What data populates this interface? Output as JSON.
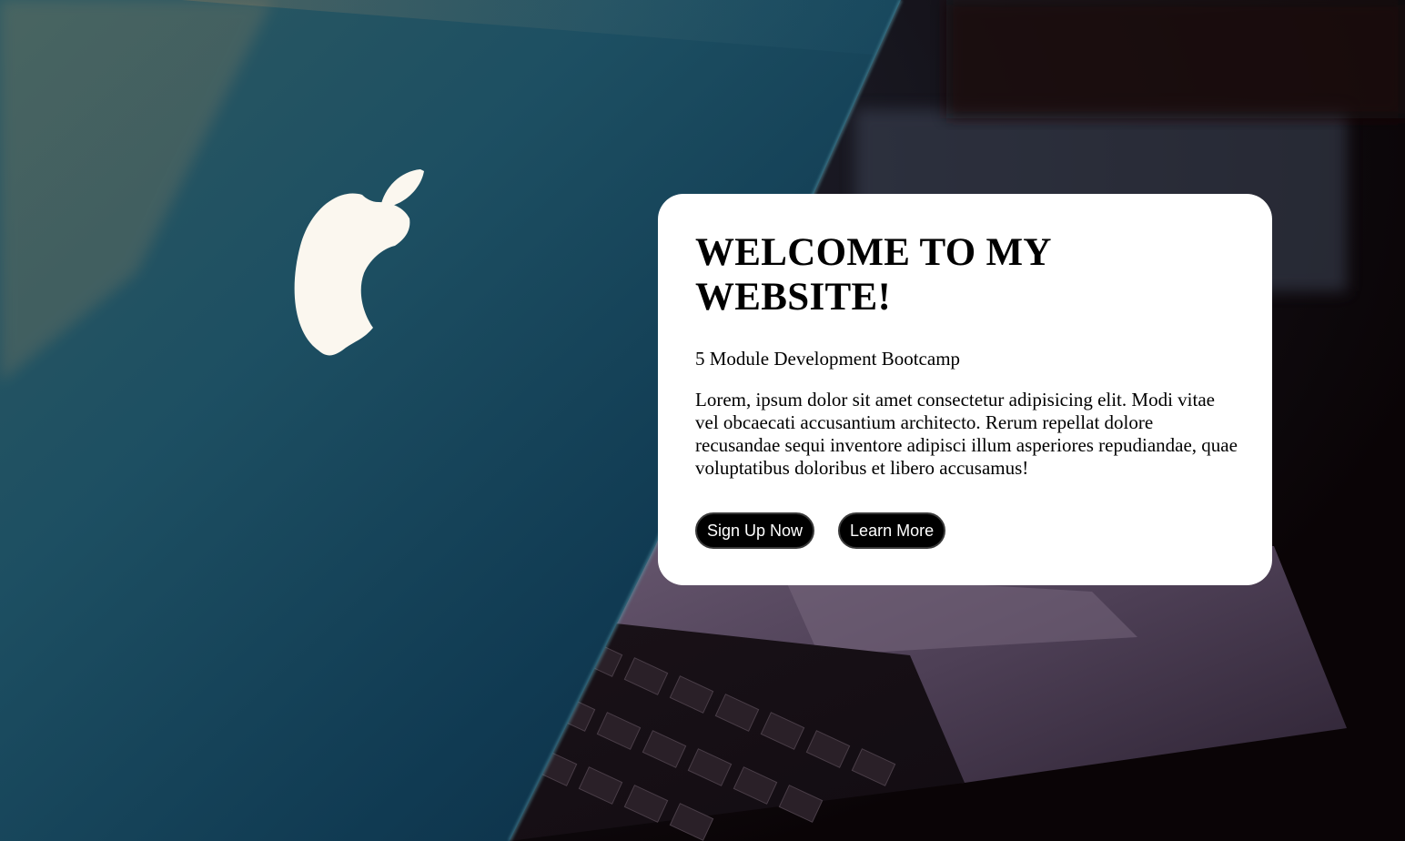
{
  "hero": {
    "title": "WELCOME TO MY WEBSITE!",
    "subtitle": "5 Module Development Bootcamp",
    "description": "Lorem, ipsum dolor sit amet consectetur adipisicing elit. Modi vitae vel obcaecati accusantium architecto. Rerum repellat dolore recusandae sequi inventore adipisci illum asperiores repudiandae, quae voluptatibus doloribus et libero accusamus!",
    "background_image": "laptop-photo",
    "buttons": {
      "signup_label": "Sign Up Now",
      "learn_more_label": "Learn More"
    }
  },
  "colors": {
    "card_background": "#ffffff",
    "button_background": "#000000",
    "button_text": "#ffffff",
    "page_background": "#0a0406"
  }
}
